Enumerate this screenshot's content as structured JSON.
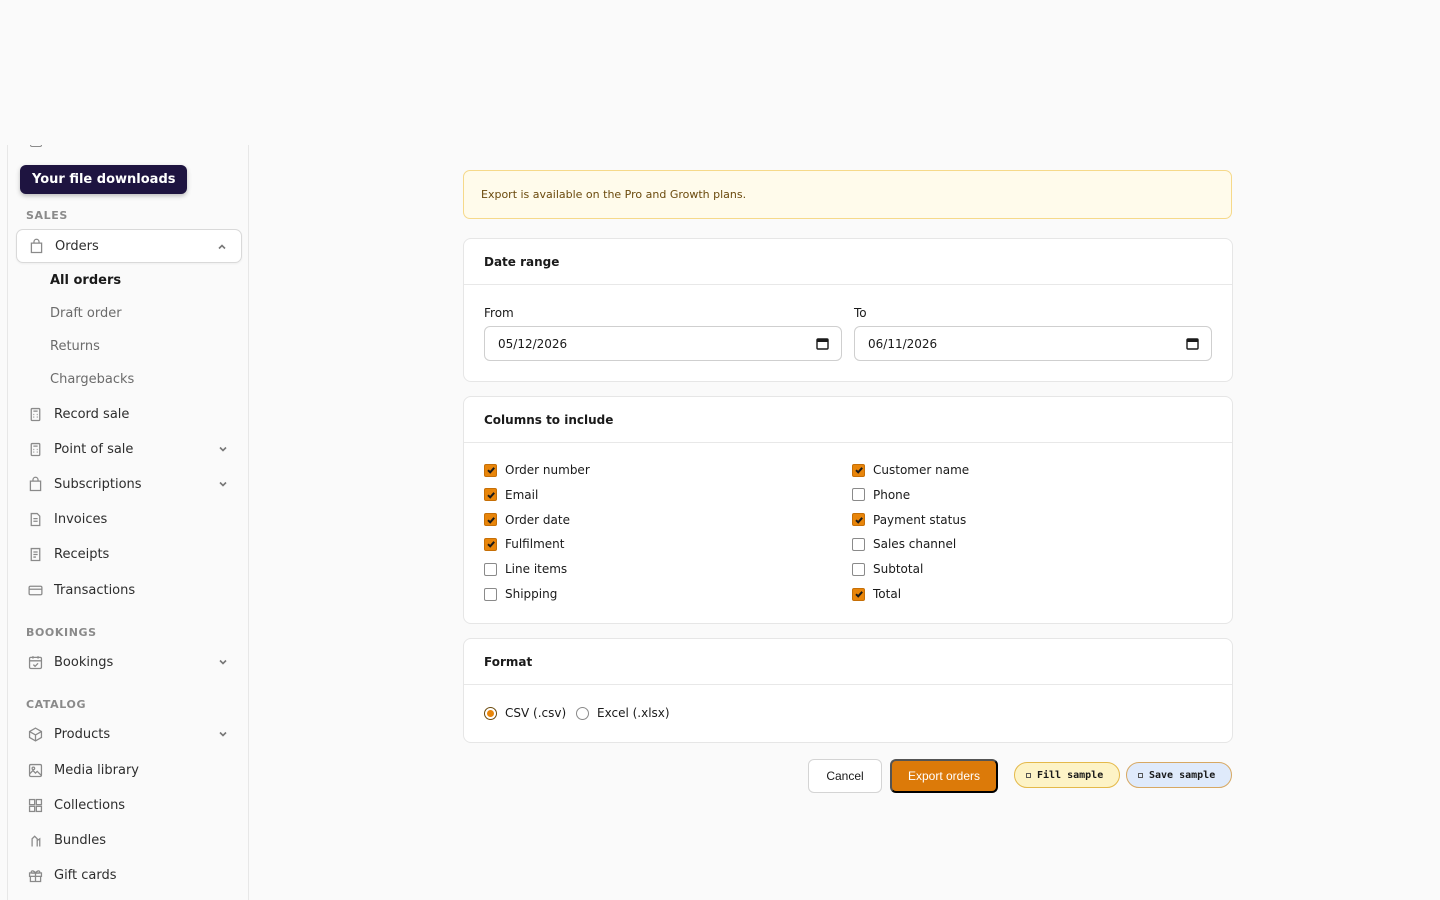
{
  "sidebar": {
    "tooltip": "Your file downloads",
    "sections": {
      "sales": "SALES",
      "bookings": "BOOKINGS",
      "catalog": "CATALOG"
    },
    "orders": {
      "label": "Orders",
      "sub_items": [
        "All orders",
        "Draft order",
        "Returns",
        "Chargebacks"
      ]
    },
    "items": {
      "record_sale": "Record sale",
      "point_of_sale": "Point of sale",
      "subscriptions": "Subscriptions",
      "invoices": "Invoices",
      "receipts": "Receipts",
      "transactions": "Transactions",
      "bookings": "Bookings",
      "products": "Products",
      "media_library": "Media library",
      "collections": "Collections",
      "bundles": "Bundles",
      "gift_cards": "Gift cards"
    }
  },
  "alert": {
    "text": "Export is available on the Pro and Growth plans."
  },
  "date_range": {
    "title": "Date range",
    "from_label": "From",
    "from_value": "05/12/2026",
    "to_label": "To",
    "to_value": "06/11/2026"
  },
  "columns": {
    "title": "Columns to include",
    "left": [
      {
        "label": "Order number",
        "checked": true
      },
      {
        "label": "Email",
        "checked": true
      },
      {
        "label": "Order date",
        "checked": true
      },
      {
        "label": "Fulfilment",
        "checked": true
      },
      {
        "label": "Line items",
        "checked": false
      },
      {
        "label": "Shipping",
        "checked": false
      }
    ],
    "right": [
      {
        "label": "Customer name",
        "checked": true
      },
      {
        "label": "Phone",
        "checked": false
      },
      {
        "label": "Payment status",
        "checked": true
      },
      {
        "label": "Sales channel",
        "checked": false
      },
      {
        "label": "Subtotal",
        "checked": false
      },
      {
        "label": "Total",
        "checked": true
      }
    ]
  },
  "format": {
    "title": "Format",
    "options": [
      {
        "label": "CSV (.csv)",
        "selected": true
      },
      {
        "label": "Excel (.xlsx)",
        "selected": false
      }
    ]
  },
  "actions": {
    "cancel": "Cancel",
    "export": "Export orders",
    "fill_sample": "Fill sample",
    "save_sample": "Save sample"
  },
  "colors": {
    "accent": "#dc7a09",
    "checkbox": "#e8850a",
    "tooltip_bg": "#1e1440",
    "alert_bg": "#fffbeb"
  }
}
